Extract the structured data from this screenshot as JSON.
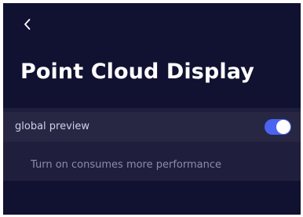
{
  "header": {
    "back_icon": "chevron-left-icon",
    "title": "Point Cloud Display"
  },
  "settings": {
    "global_preview": {
      "label": "global preview",
      "enabled": true
    },
    "hint": "Turn on consumes more performance"
  },
  "colors": {
    "background": "#111131",
    "card": "#1f1f3d",
    "row": "#272744",
    "accent": "#4a63f0",
    "label": "#cfd0e6",
    "hint": "#8b8ca7"
  }
}
